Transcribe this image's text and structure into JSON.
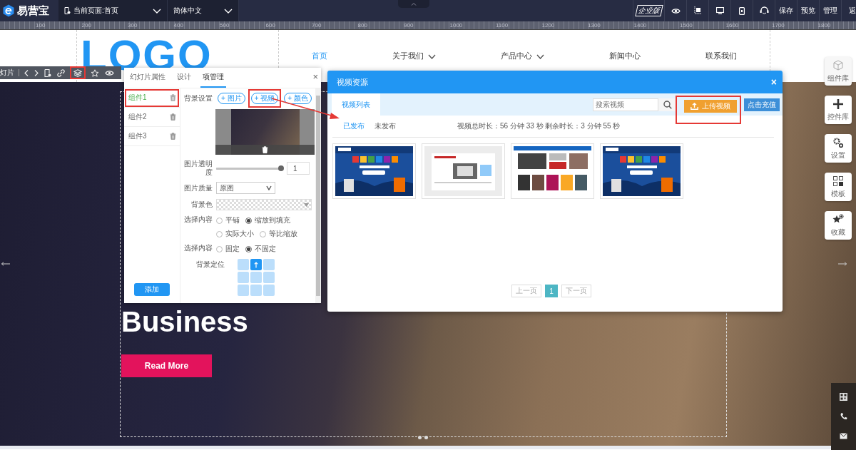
{
  "top_bar": {
    "brand": "易营宝",
    "page_select": "当前页面:首页",
    "language_select": "简体中文",
    "edition_badge": "企业版",
    "tools": [
      {
        "kind": "eye"
      },
      {
        "kind": "crop"
      },
      {
        "kind": "desktop"
      },
      {
        "kind": "mobile"
      },
      {
        "kind": "headset"
      }
    ],
    "actions": [
      "保存",
      "预览",
      "管理",
      "返"
    ]
  },
  "ruler": {
    "labels": [
      "100",
      "200",
      "300",
      "400",
      "500",
      "600",
      "700",
      "800",
      "900",
      "1000",
      "1100",
      "1200",
      "1300",
      "1400",
      "1500",
      "1600",
      "1700",
      "1800"
    ]
  },
  "site": {
    "logo": "LOGO",
    "nav": [
      {
        "label": "首页",
        "selected": true,
        "dropdown": false
      },
      {
        "label": "关于我们",
        "selected": false,
        "dropdown": true
      },
      {
        "label": "产品中心",
        "selected": false,
        "dropdown": true
      },
      {
        "label": "新闻中心",
        "selected": false,
        "dropdown": false
      },
      {
        "label": "联系我们",
        "selected": false,
        "dropdown": false
      }
    ],
    "hero": {
      "headline": "Business",
      "button": "Read More"
    }
  },
  "slide_toolbar": {
    "label": "灯片",
    "tools": [
      {
        "kind": "prev",
        "highlighted": false
      },
      {
        "kind": "next",
        "highlighted": false
      },
      {
        "kind": "page",
        "highlighted": false
      },
      {
        "kind": "link",
        "highlighted": false
      },
      {
        "kind": "layers",
        "highlighted": true
      },
      {
        "kind": "star",
        "highlighted": false
      },
      {
        "kind": "eye",
        "highlighted": false
      }
    ]
  },
  "item_panel": {
    "close": "×",
    "tabs": [
      {
        "label": "幻灯片属性",
        "selected": false
      },
      {
        "label": "设计",
        "selected": false
      },
      {
        "label": "项管理",
        "selected": true
      }
    ],
    "items": [
      {
        "label": "组件1",
        "selected": true,
        "highlighted": true
      },
      {
        "label": "组件2",
        "selected": false,
        "highlighted": false
      },
      {
        "label": "组件3",
        "selected": false,
        "highlighted": false
      }
    ],
    "add_button": "添加",
    "background": {
      "label": "背景设置",
      "buttons": [
        {
          "label": "+ 图片",
          "highlighted": false
        },
        {
          "label": "+ 视频",
          "highlighted": true
        },
        {
          "label": "+ 颜色",
          "highlighted": false
        }
      ]
    },
    "opacity": {
      "label": "图片透明度",
      "level": 0.97,
      "value": "1"
    },
    "quality": {
      "label": "图片质量",
      "value": "原图"
    },
    "background_color": {
      "label": "背景色"
    },
    "fill_mode": {
      "label": "选择内容",
      "options": [
        {
          "label": "平铺",
          "selected": false
        },
        {
          "label": "缩放到填充",
          "selected": true
        },
        {
          "label": "实际大小",
          "selected": false
        },
        {
          "label": "等比缩放",
          "selected": false
        }
      ]
    },
    "attachment": {
      "label": "选择内容",
      "options": [
        {
          "label": "固定",
          "selected": false
        },
        {
          "label": "不固定",
          "selected": true
        }
      ]
    },
    "position": {
      "label": "背景定位",
      "cells": [
        {
          "selected": false
        },
        {
          "selected": true
        },
        {
          "selected": false
        },
        {
          "selected": false
        },
        {
          "selected": false
        },
        {
          "selected": false
        },
        {
          "selected": false
        },
        {
          "selected": false
        },
        {
          "selected": false
        }
      ]
    }
  },
  "video_dialog": {
    "title": "视频资源",
    "close": "×",
    "tabs": [
      {
        "label": "视频列表",
        "selected": true
      }
    ],
    "search": {
      "placeholder": "搜索视频"
    },
    "upload_button": {
      "label": "上传视频",
      "highlighted": true
    },
    "recharge_button": "点击充值",
    "filters": [
      {
        "label": "已发布",
        "selected": true
      },
      {
        "label": "未发布",
        "selected": false
      }
    ],
    "usage": "视频总时长：56 分钟 33 秒 剩余时长：3 分钟 55 秒",
    "videos": [
      {
        "kind": "poster"
      },
      {
        "kind": "webpage"
      },
      {
        "kind": "website"
      },
      {
        "kind": "poster"
      }
    ],
    "pagination": {
      "prev": "上一页",
      "pages": [
        {
          "label": "1",
          "selected": true
        }
      ],
      "next": "下一页"
    }
  },
  "dock": {
    "items": [
      {
        "label": "组件库",
        "kind": "cube"
      },
      {
        "label": "控件库",
        "kind": "plus"
      },
      {
        "label": "设置",
        "kind": "gears"
      },
      {
        "label": "模板",
        "kind": "grid"
      },
      {
        "label": "收藏",
        "kind": "star"
      }
    ],
    "contacts": [
      {
        "kind": "qr"
      },
      {
        "kind": "phone"
      },
      {
        "kind": "mail"
      }
    ]
  }
}
